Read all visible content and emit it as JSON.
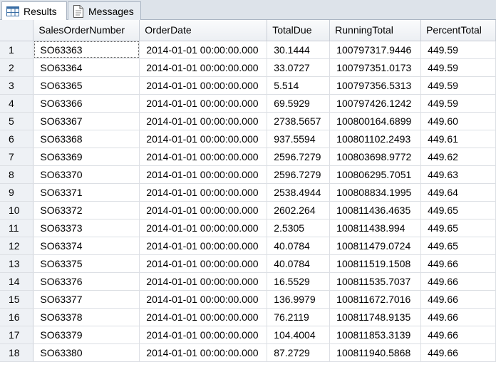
{
  "tabs": [
    {
      "label": "Results",
      "icon": "grid-icon"
    },
    {
      "label": "Messages",
      "icon": "document-icon"
    }
  ],
  "columns": [
    "",
    "SalesOrderNumber",
    "OrderDate",
    "TotalDue",
    "RunningTotal",
    "PercentTotal"
  ],
  "rows": [
    [
      "1",
      "SO63363",
      "2014-01-01 00:00:00.000",
      "30.1444",
      "100797317.9446",
      "449.59"
    ],
    [
      "2",
      "SO63364",
      "2014-01-01 00:00:00.000",
      "33.0727",
      "100797351.0173",
      "449.59"
    ],
    [
      "3",
      "SO63365",
      "2014-01-01 00:00:00.000",
      "5.514",
      "100797356.5313",
      "449.59"
    ],
    [
      "4",
      "SO63366",
      "2014-01-01 00:00:00.000",
      "69.5929",
      "100797426.1242",
      "449.59"
    ],
    [
      "5",
      "SO63367",
      "2014-01-01 00:00:00.000",
      "2738.5657",
      "100800164.6899",
      "449.60"
    ],
    [
      "6",
      "SO63368",
      "2014-01-01 00:00:00.000",
      "937.5594",
      "100801102.2493",
      "449.61"
    ],
    [
      "7",
      "SO63369",
      "2014-01-01 00:00:00.000",
      "2596.7279",
      "100803698.9772",
      "449.62"
    ],
    [
      "8",
      "SO63370",
      "2014-01-01 00:00:00.000",
      "2596.7279",
      "100806295.7051",
      "449.63"
    ],
    [
      "9",
      "SO63371",
      "2014-01-01 00:00:00.000",
      "2538.4944",
      "100808834.1995",
      "449.64"
    ],
    [
      "10",
      "SO63372",
      "2014-01-01 00:00:00.000",
      "2602.264",
      "100811436.4635",
      "449.65"
    ],
    [
      "11",
      "SO63373",
      "2014-01-01 00:00:00.000",
      "2.5305",
      "100811438.994",
      "449.65"
    ],
    [
      "12",
      "SO63374",
      "2014-01-01 00:00:00.000",
      "40.0784",
      "100811479.0724",
      "449.65"
    ],
    [
      "13",
      "SO63375",
      "2014-01-01 00:00:00.000",
      "40.0784",
      "100811519.1508",
      "449.66"
    ],
    [
      "14",
      "SO63376",
      "2014-01-01 00:00:00.000",
      "16.5529",
      "100811535.7037",
      "449.66"
    ],
    [
      "15",
      "SO63377",
      "2014-01-01 00:00:00.000",
      "136.9979",
      "100811672.7016",
      "449.66"
    ],
    [
      "16",
      "SO63378",
      "2014-01-01 00:00:00.000",
      "76.2119",
      "100811748.9135",
      "449.66"
    ],
    [
      "17",
      "SO63379",
      "2014-01-01 00:00:00.000",
      "104.4004",
      "100811853.3139",
      "449.66"
    ],
    [
      "18",
      "SO63380",
      "2014-01-01 00:00:00.000",
      "87.2729",
      "100811940.5868",
      "449.66"
    ]
  ],
  "colors": {
    "accent": "#1f6fb2",
    "header_bg": "#eceff3",
    "tab_bg": "#dde3ea"
  }
}
